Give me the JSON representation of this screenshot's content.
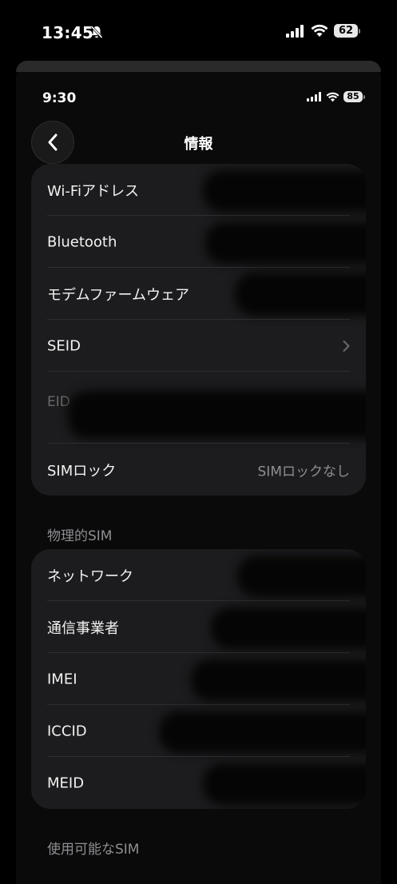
{
  "outer_status": {
    "time": "13:45",
    "battery": "62"
  },
  "inner_status": {
    "time": "9:30",
    "battery": "85"
  },
  "nav": {
    "title": "情報"
  },
  "info_card": {
    "rows": [
      {
        "label": "Wi-Fiアドレス"
      },
      {
        "label": "Bluetooth"
      },
      {
        "label": "モデムファームウェア"
      },
      {
        "label": "SEID"
      },
      {
        "label": "EID"
      },
      {
        "label": "SIMロック",
        "value": "SIMロックなし"
      }
    ]
  },
  "physical_sim": {
    "header": "物理的SIM",
    "rows": [
      {
        "label": "ネットワーク"
      },
      {
        "label": "通信事業者"
      },
      {
        "label": "IMEI"
      },
      {
        "label": "ICCID"
      },
      {
        "label": "MEID"
      }
    ]
  },
  "available_sim": {
    "header": "使用可能なSIM"
  }
}
